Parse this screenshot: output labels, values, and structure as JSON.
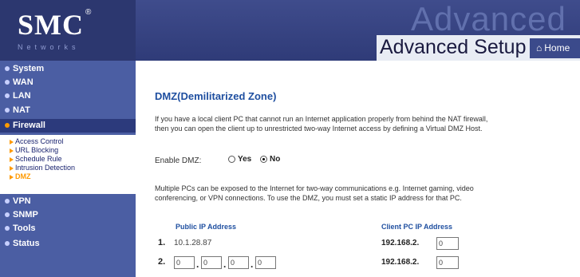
{
  "header": {
    "logo": "SMC",
    "logo_reg": "®",
    "logo_sub": "Networks",
    "watermark": "Advanced",
    "title": "Advanced Setup",
    "home_label": "Home",
    "home_icon": "home-icon"
  },
  "sidebar": {
    "items": [
      {
        "label": "System"
      },
      {
        "label": "WAN"
      },
      {
        "label": "LAN"
      },
      {
        "label": "NAT"
      },
      {
        "label": "Firewall",
        "active": true
      },
      {
        "label": "VPN"
      },
      {
        "label": "SNMP"
      },
      {
        "label": "Tools"
      },
      {
        "label": "Status"
      }
    ],
    "subitems": [
      {
        "label": "Access Control"
      },
      {
        "label": "URL Blocking"
      },
      {
        "label": "Schedule Rule"
      },
      {
        "label": "Intrusion Detection"
      },
      {
        "label": "DMZ",
        "active": true
      }
    ]
  },
  "main": {
    "title": "DMZ(Demilitarized Zone)",
    "description_line1": "If you have a local client PC that cannot run an Internet application properly from behind the NAT firewall,",
    "description_line2": "then you can open the client up to unrestricted two-way Internet access by defining a Virtual DMZ Host.",
    "enable_label": "Enable DMZ:",
    "enable_options": [
      {
        "label": "Yes",
        "checked": false
      },
      {
        "label": "No",
        "checked": true
      }
    ],
    "multi_line1": "Multiple PCs can be exposed to the Internet for two-way communications e.g. Internet gaming, video",
    "multi_line2": "conferencing, or VPN connections.  To use the DMZ, you must set a static IP address for that PC.",
    "col_public": "Public IP Address",
    "col_client": "Client PC IP Address",
    "rows": [
      {
        "num": "1.",
        "public_ip": "10.1.28.87",
        "client_prefix": "192.168.2.",
        "client_octet": "0"
      },
      {
        "num": "2.",
        "public_octets": [
          "0",
          "0",
          "0",
          "0"
        ],
        "client_prefix": "192.168.2.",
        "client_octet": "0"
      }
    ]
  },
  "colors": {
    "header_bg": "#3f4c8c",
    "sidebar_bg": "#4b5ea3",
    "title_blue": "#1f4fa0",
    "active_orange": "#ff9a00"
  }
}
